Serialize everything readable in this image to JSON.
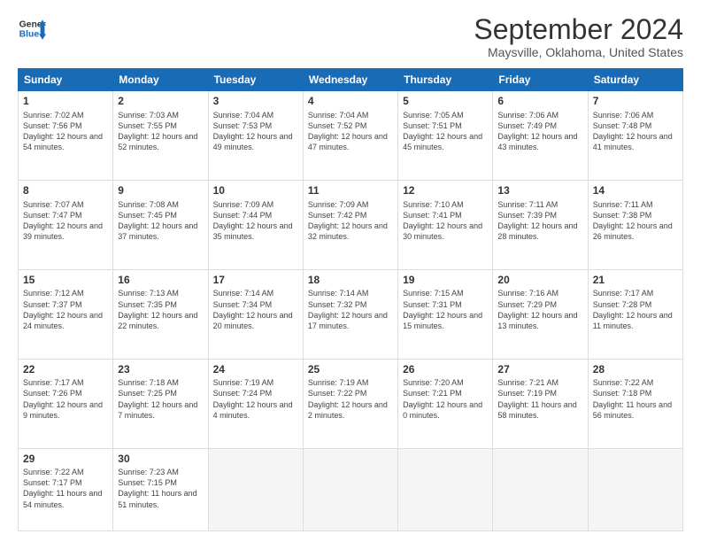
{
  "header": {
    "logo_line1": "General",
    "logo_line2": "Blue",
    "main_title": "September 2024",
    "subtitle": "Maysville, Oklahoma, United States"
  },
  "columns": [
    "Sunday",
    "Monday",
    "Tuesday",
    "Wednesday",
    "Thursday",
    "Friday",
    "Saturday"
  ],
  "weeks": [
    [
      {
        "num": "1",
        "sunrise": "7:02 AM",
        "sunset": "7:56 PM",
        "daylight": "12 hours and 54 minutes."
      },
      {
        "num": "2",
        "sunrise": "7:03 AM",
        "sunset": "7:55 PM",
        "daylight": "12 hours and 52 minutes."
      },
      {
        "num": "3",
        "sunrise": "7:04 AM",
        "sunset": "7:53 PM",
        "daylight": "12 hours and 49 minutes."
      },
      {
        "num": "4",
        "sunrise": "7:04 AM",
        "sunset": "7:52 PM",
        "daylight": "12 hours and 47 minutes."
      },
      {
        "num": "5",
        "sunrise": "7:05 AM",
        "sunset": "7:51 PM",
        "daylight": "12 hours and 45 minutes."
      },
      {
        "num": "6",
        "sunrise": "7:06 AM",
        "sunset": "7:49 PM",
        "daylight": "12 hours and 43 minutes."
      },
      {
        "num": "7",
        "sunrise": "7:06 AM",
        "sunset": "7:48 PM",
        "daylight": "12 hours and 41 minutes."
      }
    ],
    [
      {
        "num": "8",
        "sunrise": "7:07 AM",
        "sunset": "7:47 PM",
        "daylight": "12 hours and 39 minutes."
      },
      {
        "num": "9",
        "sunrise": "7:08 AM",
        "sunset": "7:45 PM",
        "daylight": "12 hours and 37 minutes."
      },
      {
        "num": "10",
        "sunrise": "7:09 AM",
        "sunset": "7:44 PM",
        "daylight": "12 hours and 35 minutes."
      },
      {
        "num": "11",
        "sunrise": "7:09 AM",
        "sunset": "7:42 PM",
        "daylight": "12 hours and 32 minutes."
      },
      {
        "num": "12",
        "sunrise": "7:10 AM",
        "sunset": "7:41 PM",
        "daylight": "12 hours and 30 minutes."
      },
      {
        "num": "13",
        "sunrise": "7:11 AM",
        "sunset": "7:39 PM",
        "daylight": "12 hours and 28 minutes."
      },
      {
        "num": "14",
        "sunrise": "7:11 AM",
        "sunset": "7:38 PM",
        "daylight": "12 hours and 26 minutes."
      }
    ],
    [
      {
        "num": "15",
        "sunrise": "7:12 AM",
        "sunset": "7:37 PM",
        "daylight": "12 hours and 24 minutes."
      },
      {
        "num": "16",
        "sunrise": "7:13 AM",
        "sunset": "7:35 PM",
        "daylight": "12 hours and 22 minutes."
      },
      {
        "num": "17",
        "sunrise": "7:14 AM",
        "sunset": "7:34 PM",
        "daylight": "12 hours and 20 minutes."
      },
      {
        "num": "18",
        "sunrise": "7:14 AM",
        "sunset": "7:32 PM",
        "daylight": "12 hours and 17 minutes."
      },
      {
        "num": "19",
        "sunrise": "7:15 AM",
        "sunset": "7:31 PM",
        "daylight": "12 hours and 15 minutes."
      },
      {
        "num": "20",
        "sunrise": "7:16 AM",
        "sunset": "7:29 PM",
        "daylight": "12 hours and 13 minutes."
      },
      {
        "num": "21",
        "sunrise": "7:17 AM",
        "sunset": "7:28 PM",
        "daylight": "12 hours and 11 minutes."
      }
    ],
    [
      {
        "num": "22",
        "sunrise": "7:17 AM",
        "sunset": "7:26 PM",
        "daylight": "12 hours and 9 minutes."
      },
      {
        "num": "23",
        "sunrise": "7:18 AM",
        "sunset": "7:25 PM",
        "daylight": "12 hours and 7 minutes."
      },
      {
        "num": "24",
        "sunrise": "7:19 AM",
        "sunset": "7:24 PM",
        "daylight": "12 hours and 4 minutes."
      },
      {
        "num": "25",
        "sunrise": "7:19 AM",
        "sunset": "7:22 PM",
        "daylight": "12 hours and 2 minutes."
      },
      {
        "num": "26",
        "sunrise": "7:20 AM",
        "sunset": "7:21 PM",
        "daylight": "12 hours and 0 minutes."
      },
      {
        "num": "27",
        "sunrise": "7:21 AM",
        "sunset": "7:19 PM",
        "daylight": "11 hours and 58 minutes."
      },
      {
        "num": "28",
        "sunrise": "7:22 AM",
        "sunset": "7:18 PM",
        "daylight": "11 hours and 56 minutes."
      }
    ],
    [
      {
        "num": "29",
        "sunrise": "7:22 AM",
        "sunset": "7:17 PM",
        "daylight": "11 hours and 54 minutes."
      },
      {
        "num": "30",
        "sunrise": "7:23 AM",
        "sunset": "7:15 PM",
        "daylight": "11 hours and 51 minutes."
      },
      null,
      null,
      null,
      null,
      null
    ]
  ]
}
